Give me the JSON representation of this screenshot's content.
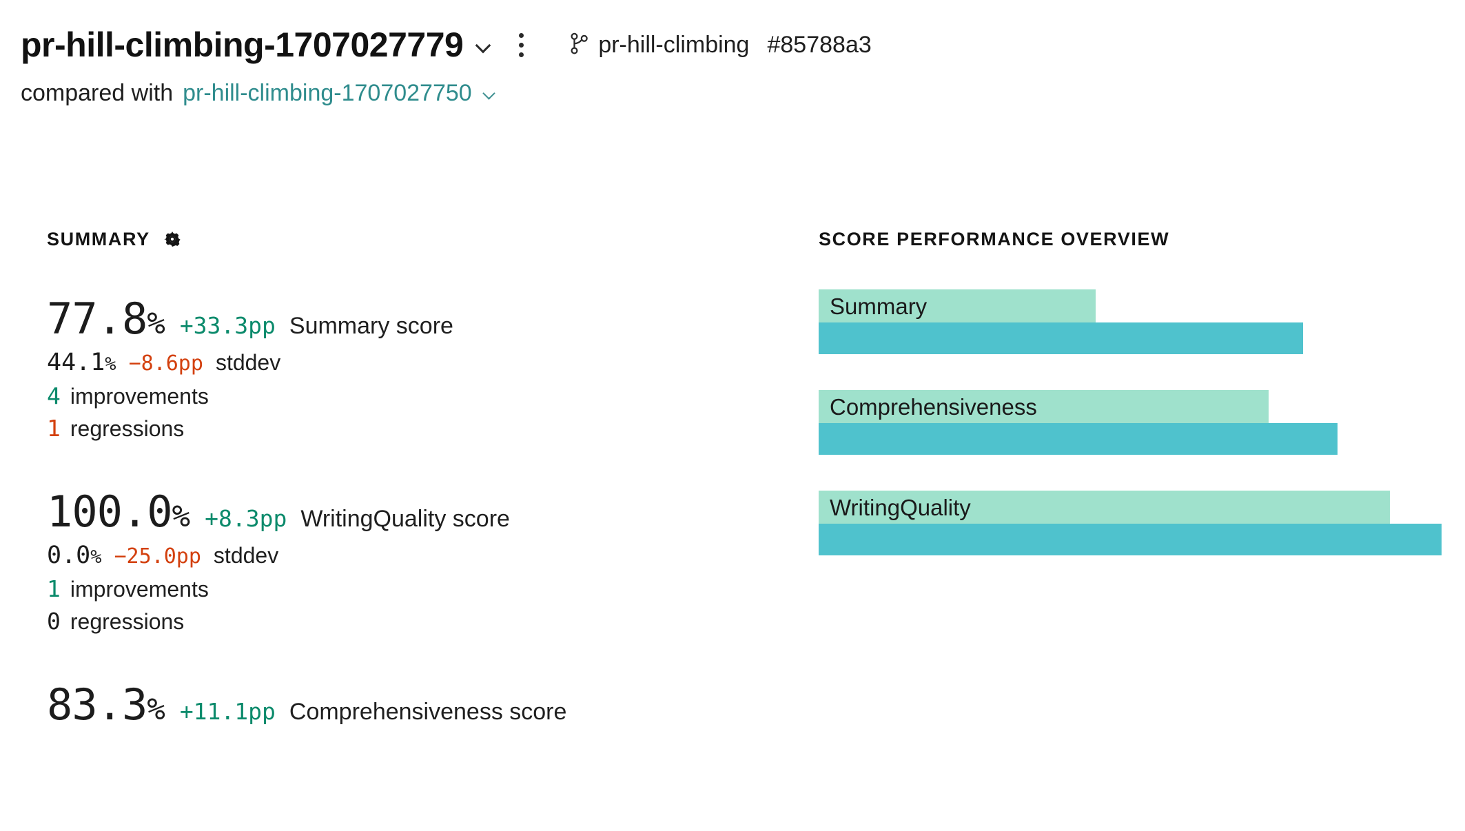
{
  "header": {
    "run_title": "pr-hill-climbing-1707027779",
    "title_chevron_icon": "chevron-down-icon",
    "menu_icon": "kebab-menu-icon",
    "branch_icon": "git-branch-icon",
    "branch_name": "pr-hill-climbing",
    "commit_sha": "#85788a3",
    "compared_label": "compared with",
    "compared_run": "pr-hill-climbing-1707027750",
    "compare_chevron_icon": "chevron-down-icon"
  },
  "summary_panel": {
    "heading": "SUMMARY",
    "settings_icon": "gear-icon",
    "blocks": [
      {
        "value": "77.8",
        "unit": "%",
        "delta": "+33.3pp",
        "delta_sign": "pos",
        "label": "Summary score",
        "stddev_value": "44.1",
        "stddev_unit": "%",
        "stddev_delta": "−8.6pp",
        "stddev_sign": "neg",
        "stddev_label": "stddev",
        "improvements_count": "4",
        "improvements_label": "improvements",
        "improvements_sign": "pos",
        "regressions_count": "1",
        "regressions_label": "regressions",
        "regressions_sign": "neg"
      },
      {
        "value": "100.0",
        "unit": "%",
        "delta": "+8.3pp",
        "delta_sign": "pos",
        "label": "WritingQuality score",
        "stddev_value": "0.0",
        "stddev_unit": "%",
        "stddev_delta": "−25.0pp",
        "stddev_sign": "neg",
        "stddev_label": "stddev",
        "improvements_count": "1",
        "improvements_label": "improvements",
        "improvements_sign": "pos",
        "regressions_count": "0",
        "regressions_label": "regressions",
        "regressions_sign": "neutral"
      },
      {
        "value": "83.3",
        "unit": "%",
        "delta": "+11.1pp",
        "delta_sign": "pos",
        "label": "Comprehensiveness score",
        "stddev_value": "",
        "stddev_unit": "",
        "stddev_delta": "",
        "stddev_sign": "neutral",
        "stddev_label": "",
        "improvements_count": "",
        "improvements_label": "",
        "improvements_sign": "neutral",
        "regressions_count": "",
        "regressions_label": "",
        "regressions_sign": "neutral"
      }
    ]
  },
  "chart_panel": {
    "heading": "SCORE PERFORMANCE OVERVIEW"
  },
  "colors": {
    "baseline_bar": "#9fe1cc",
    "current_bar": "#4fc2cd",
    "positive": "#0b8a6b",
    "negative": "#d3400e",
    "link": "#2f8c8d"
  },
  "chart_data": {
    "type": "bar",
    "orientation": "horizontal",
    "title": "SCORE PERFORMANCE OVERVIEW",
    "xlabel": "",
    "ylabel": "",
    "xlim": [
      0,
      100
    ],
    "grid": false,
    "legend": "none",
    "categories": [
      "Summary",
      "Comprehensiveness",
      "WritingQuality"
    ],
    "series": [
      {
        "name": "baseline",
        "color": "#9fe1cc",
        "values": [
          44.5,
          72.2,
          91.7
        ]
      },
      {
        "name": "current",
        "color": "#4fc2cd",
        "values": [
          77.8,
          83.3,
          100.0
        ]
      }
    ],
    "bars": [
      {
        "category": "Summary",
        "baseline": 44.5,
        "current": 77.8
      },
      {
        "category": "Comprehensiveness",
        "baseline": 72.2,
        "current": 83.3
      },
      {
        "category": "WritingQuality",
        "baseline": 91.7,
        "current": 100.0
      }
    ]
  }
}
